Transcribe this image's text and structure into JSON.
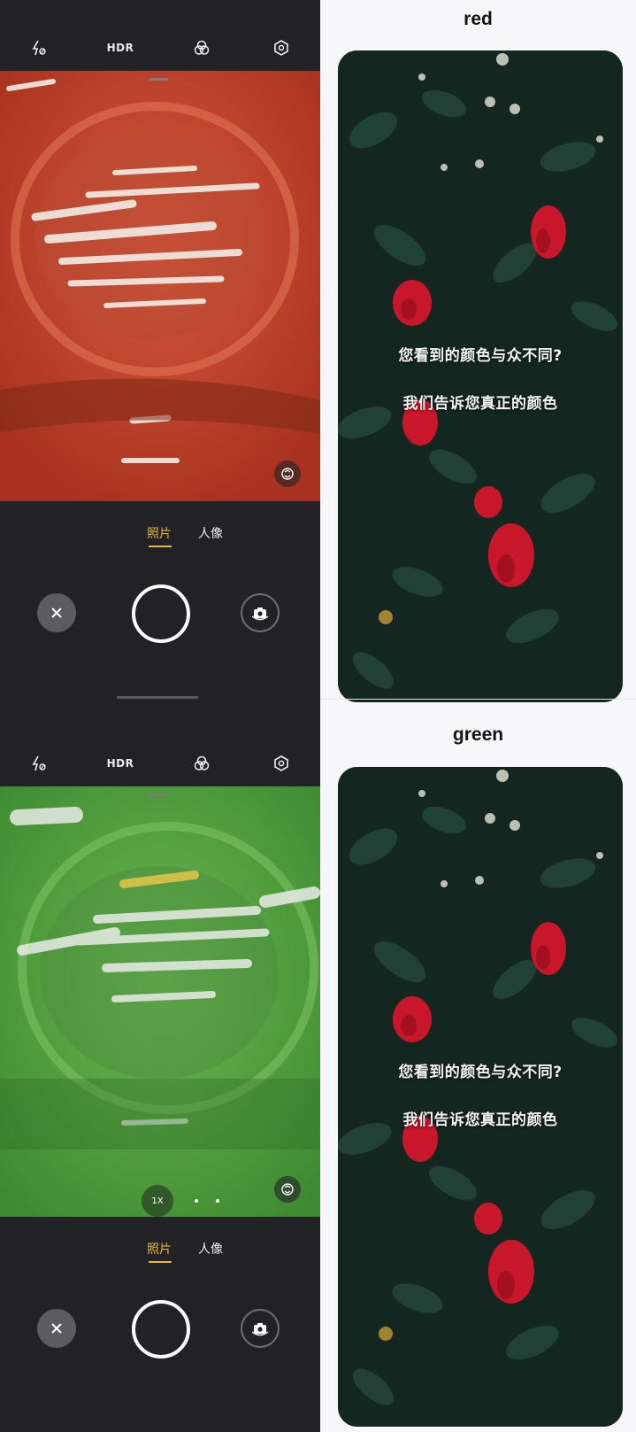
{
  "camera_screens": [
    {
      "variant": "red",
      "toolbar": {
        "flash_icon": "flash-auto-icon",
        "hdr_label": "HDR",
        "filter_icon": "filter-icon",
        "settings_icon": "settings-icon"
      },
      "viewfinder_color": "#c8412c",
      "modes": {
        "active": "照片",
        "inactive": "人像"
      },
      "buttons": {
        "close_icon": "close-icon",
        "shutter": "shutter-button",
        "flip_icon": "flip-camera-icon",
        "switch_icon": "switch-lens-icon"
      }
    },
    {
      "variant": "green",
      "toolbar": {
        "flash_icon": "flash-auto-icon",
        "hdr_label": "HDR",
        "filter_icon": "filter-icon",
        "settings_icon": "settings-icon"
      },
      "viewfinder_color": "#52a23a",
      "zoom_label": "1X",
      "modes": {
        "active": "照片",
        "inactive": "人像"
      },
      "buttons": {
        "close_icon": "close-icon",
        "shutter": "shutter-button",
        "flip_icon": "flip-camera-icon",
        "switch_icon": "switch-lens-icon"
      }
    }
  ],
  "panels": [
    {
      "title": "red",
      "lines": [
        "您看到的颜色与众不同?",
        "我们告诉您真正的颜色"
      ]
    },
    {
      "title": "green",
      "lines": [
        "您看到的颜色与众不同?",
        "我们告诉您真正的颜色"
      ]
    }
  ],
  "colors": {
    "accent_yellow": "#e9b437",
    "camera_bg": "#222226",
    "rose_red": "#c8172a",
    "foliage": "#1d3a2c"
  }
}
